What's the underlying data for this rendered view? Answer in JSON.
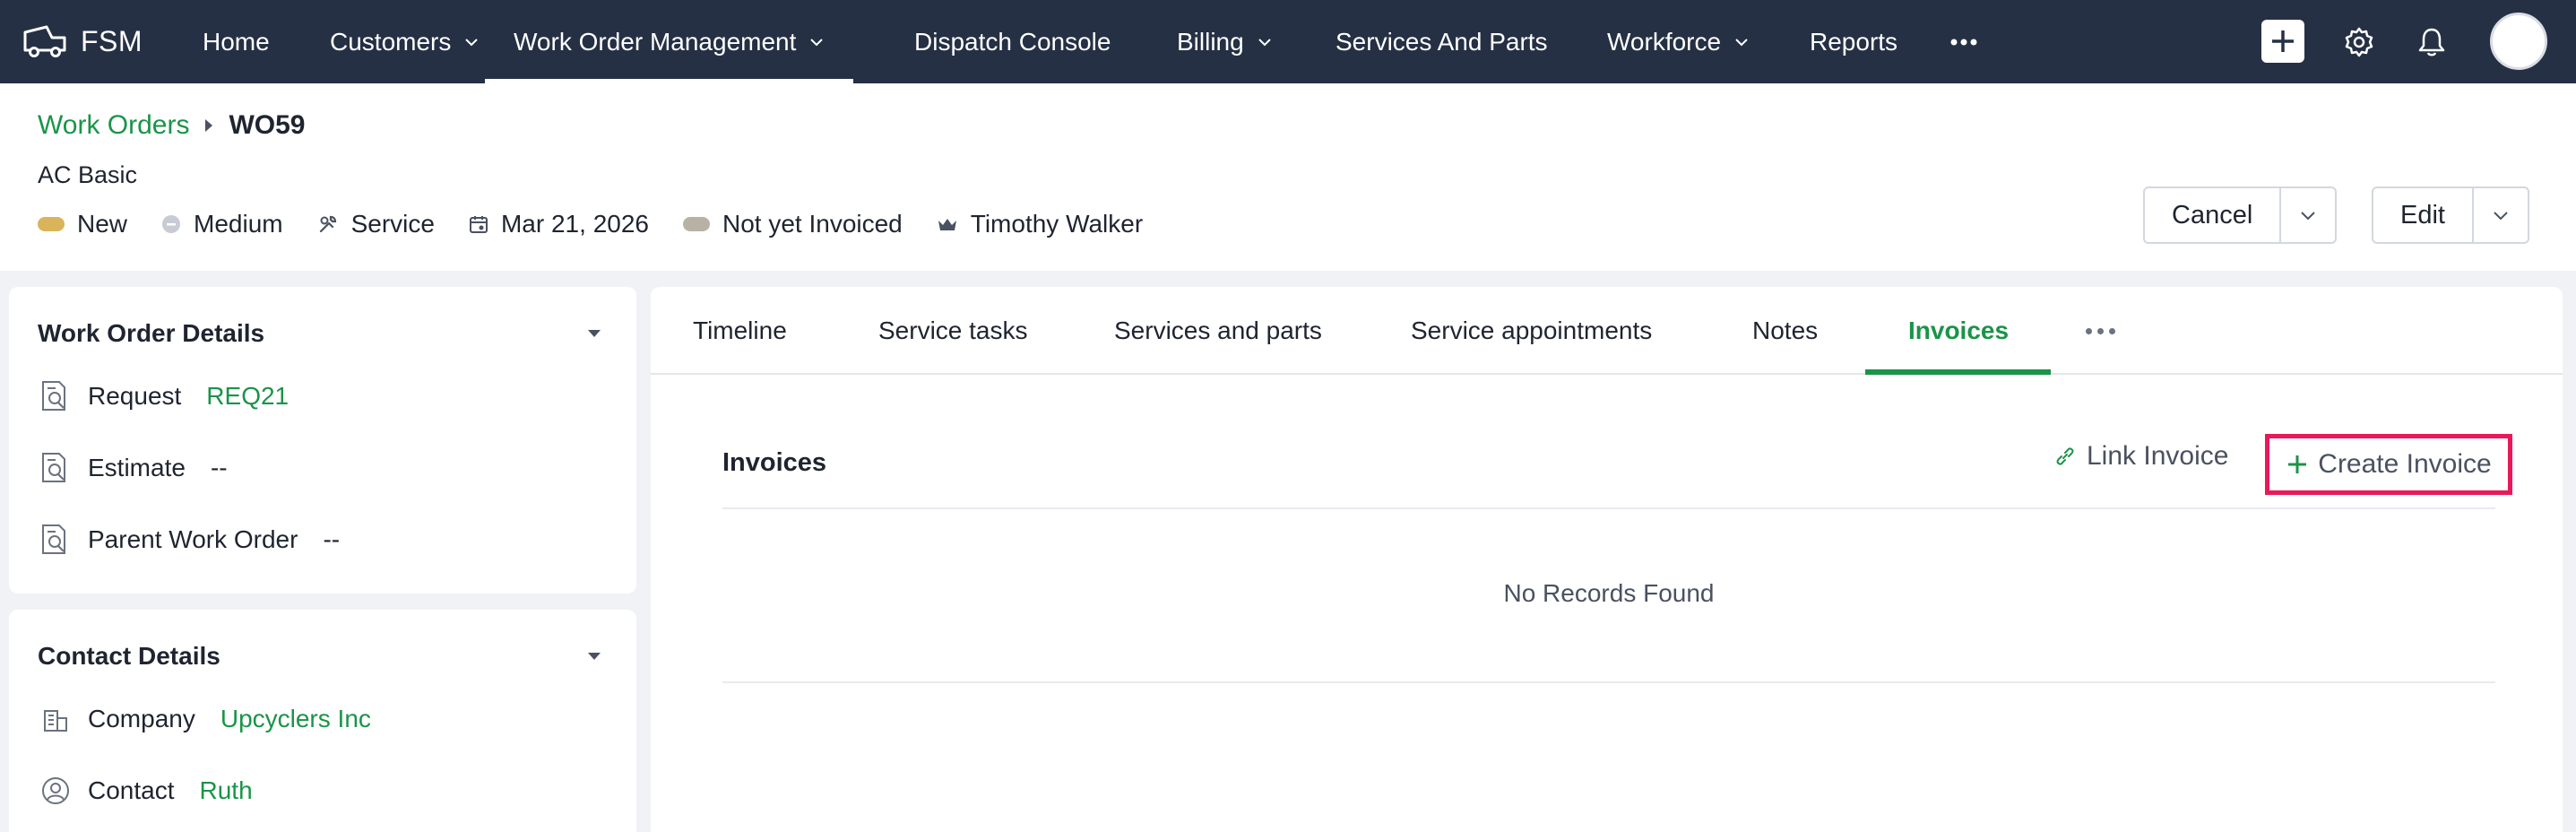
{
  "app": {
    "name": "FSM"
  },
  "nav": {
    "items": [
      {
        "label": "Home"
      },
      {
        "label": "Customers"
      },
      {
        "label": "Work Order Management"
      },
      {
        "label": "Dispatch Console"
      },
      {
        "label": "Billing"
      },
      {
        "label": "Services And Parts"
      },
      {
        "label": "Workforce"
      },
      {
        "label": "Reports"
      }
    ],
    "active": "Work Order Management"
  },
  "breadcrumb": {
    "parent": "Work Orders",
    "current": "WO59"
  },
  "record": {
    "subtitle": "AC Basic",
    "status": "New",
    "priority": "Medium",
    "type": "Service",
    "date": "Mar 21, 2026",
    "billing_status": "Not yet Invoiced",
    "owner": "Timothy Walker"
  },
  "actions": {
    "cancel_label": "Cancel",
    "edit_label": "Edit"
  },
  "work_order_details": {
    "title": "Work Order Details",
    "rows": [
      {
        "label": "Request",
        "value": "REQ21"
      },
      {
        "label": "Estimate",
        "value": "--"
      },
      {
        "label": "Parent Work Order",
        "value": "--"
      }
    ]
  },
  "contact_details": {
    "title": "Contact Details",
    "rows": [
      {
        "label": "Company",
        "value": "Upcyclers Inc"
      },
      {
        "label": "Contact",
        "value": "Ruth"
      }
    ]
  },
  "tabs": {
    "items": [
      {
        "label": "Timeline"
      },
      {
        "label": "Service tasks"
      },
      {
        "label": "Services and parts"
      },
      {
        "label": "Service appointments"
      },
      {
        "label": "Notes"
      },
      {
        "label": "Invoices"
      }
    ],
    "active": "Invoices"
  },
  "invoices": {
    "title": "Invoices",
    "link_label": "Link Invoice",
    "create_label": "Create Invoice",
    "empty_text": "No Records Found"
  },
  "colors": {
    "nav_bg": "#253044",
    "accent_green": "#1a9448",
    "highlight_pink": "#e8185b",
    "status_new": "#d9b45a",
    "billing_pill": "#b8b2a4"
  }
}
